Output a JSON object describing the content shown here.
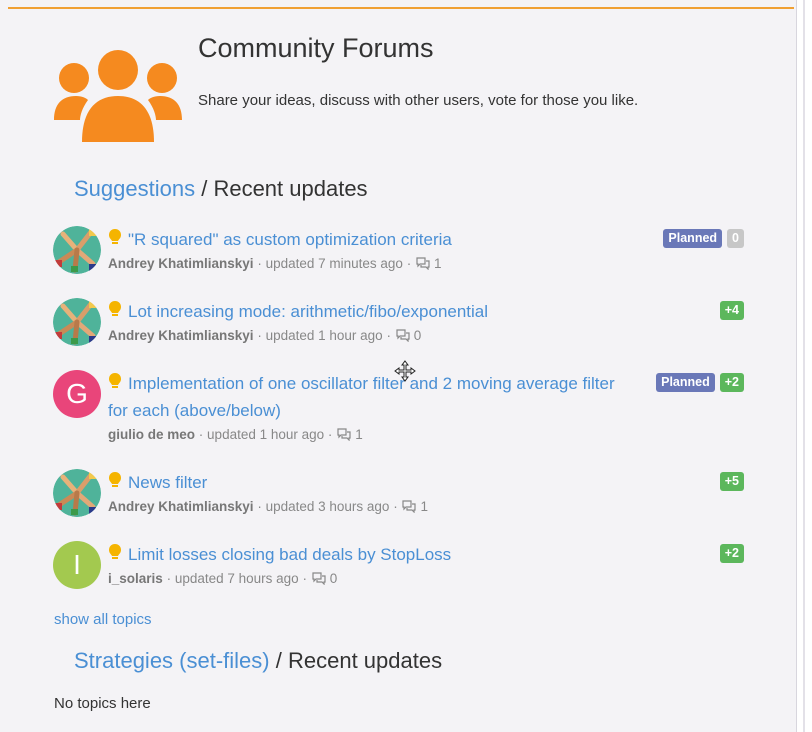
{
  "header": {
    "title": "Community Forums",
    "description": "Share your ideas, discuss with other users, vote for those you like.",
    "icon": "users-group-icon",
    "accent_color": "#f58a1f"
  },
  "suggestions": {
    "link_label": "Suggestions",
    "suffix": "/ Recent updates",
    "topics": [
      {
        "title": "\"R squared\" as custom optimization criteria",
        "author": "Andrey Khatimlianskyi",
        "updated": "updated 7 minutes ago",
        "comments": "1",
        "status": "Planned",
        "votes": "0",
        "vote_color": "#c7c7c7"
      },
      {
        "title": "Lot increasing mode: arithmetic/fibo/exponential",
        "author": "Andrey Khatimlianskyi",
        "updated": "updated 1 hour ago",
        "comments": "0",
        "votes": "+4",
        "vote_color": "#5cb75c"
      },
      {
        "title": "Implementation of one oscillator filter and 2 moving average filter for each (above/below)",
        "author": "giulio de meo",
        "updated": "updated 1 hour ago",
        "comments": "1",
        "status": "Planned",
        "votes": "+2",
        "vote_color": "#5cb75c",
        "avatar_letter": "G",
        "avatar_color": "#e9457a"
      },
      {
        "title": "News filter",
        "author": "Andrey Khatimlianskyi",
        "updated": "updated 3 hours ago",
        "comments": "1",
        "votes": "+5",
        "vote_color": "#5cb75c"
      },
      {
        "title": "Limit losses closing bad deals by StopLoss",
        "author": "i_solaris",
        "updated": "updated 7 hours ago",
        "comments": "0",
        "votes": "+2",
        "vote_color": "#5cb75c",
        "avatar_letter": "I",
        "avatar_color": "#a3c94f"
      }
    ],
    "show_all": "show all topics"
  },
  "strategies": {
    "link_label": "Strategies (set-files)",
    "suffix": "/ Recent updates",
    "empty_text": "No topics here"
  },
  "separator": "·"
}
